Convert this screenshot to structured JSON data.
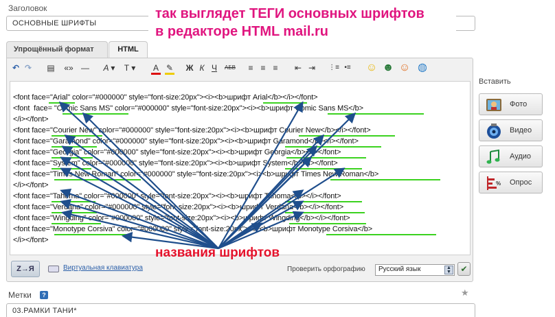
{
  "title_field": {
    "label": "Заголовок",
    "value": "ОСНОВНЫЕ ШРИФТЫ"
  },
  "annotation_top": {
    "line1": "так выглядет ТЕГИ основных шрифтов",
    "line2": "в редакторе HTML mail.ru",
    "color": "#e0157f"
  },
  "tabs": [
    {
      "label": "Упрощённый формат",
      "active": false
    },
    {
      "label": "HTML",
      "active": true
    }
  ],
  "toolbar": {
    "items": [
      {
        "name": "undo-icon",
        "glyph": "↶"
      },
      {
        "name": "redo-icon",
        "glyph": "↷"
      },
      {
        "name": "paragraph-format-icon",
        "glyph": "▤"
      },
      {
        "name": "quote-icon",
        "glyph": "«»"
      },
      {
        "name": "horizontal-rule-icon",
        "glyph": "—"
      },
      {
        "name": "font-name-icon",
        "glyph": "A ▾"
      },
      {
        "name": "font-size-icon",
        "glyph": "T ▾"
      },
      {
        "name": "text-color-icon",
        "glyph": "A"
      },
      {
        "name": "highlight-icon",
        "glyph": "✎"
      },
      {
        "name": "bold-icon",
        "glyph": "Ж"
      },
      {
        "name": "italic-icon",
        "glyph": "К"
      },
      {
        "name": "underline-icon",
        "glyph": "Ч"
      },
      {
        "name": "strikethrough-icon",
        "glyph": "АБВ"
      },
      {
        "name": "align-left-icon",
        "glyph": "≡"
      },
      {
        "name": "align-center-icon",
        "glyph": "≡"
      },
      {
        "name": "align-right-icon",
        "glyph": "≡"
      },
      {
        "name": "outdent-icon",
        "glyph": "⇤"
      },
      {
        "name": "indent-icon",
        "glyph": "⇥"
      },
      {
        "name": "numbered-list-icon",
        "glyph": "⋮≡"
      },
      {
        "name": "bullet-list-icon",
        "glyph": "•≡"
      },
      {
        "name": "smiley-icon",
        "glyph": "☺"
      },
      {
        "name": "user-icon",
        "glyph": "☻"
      },
      {
        "name": "emoticons-icon",
        "glyph": "☺"
      },
      {
        "name": "globe-icon",
        "glyph": "◍"
      }
    ]
  },
  "code_lines": [
    "<font face=\"Arial\" color=\"#000000\" style=\"font-size:20px\"><i><b>шрифт Arial</b></i></font>",
    "<font  face= \"Comic Sans MS\" color=\"#000000\" style=\"font-size:20px\"><i><b>шрифт Comic Sans MS</b>",
    "</i></font>",
    "<font face=\"Courier New\" color=\"#000000\" style=\"font-size:20px\"><i><b>шрифт Courier New</b></i></font>",
    "<font face=\"Garamond\" color=\"#000000\" style=\"font-size:20px\"><i><b>шрифт Garamond</b></i></font>",
    "<font face=\"Georgia\" color=\"#000000\" style=\"font-size:20px\"><i><b>шрифт Georgia</b></i></font>",
    "<font face=\"System\" color=\"#000000\" style=\"font-size:20px\"><i><b>шрифт System</b></i></font>",
    "<font face=\"Times New Roman\" color=\"#000000\" style=\"font-size:20px\"><i><b>шрифт Times New Roman</b>",
    "</i></font>",
    "<font face=\"Tahoma\" color=\"#000000\" style=\"font-size:20px\"><i><b>шрифт Tahoma</b></i></font>",
    "<font face=\"Verdana\" color=\"#000000\" style=\"font-size:20px\"><i><b>шрифт Verdana</b></i></font>",
    "<font face=\"Wingding\" color=\"#000000\" style=\"font-size:20px\"><i><b>шрифт Wingding</b></i></font>",
    "<font face=\"Monotype Corsiva\" color=\"#000000\" style=\"font-size:20px\"><i><b>шрифт Monotype Corsiva</b>",
    "</i></font>"
  ],
  "annotation_bottom": {
    "text": "названия шрифтов",
    "color": "#e5122b"
  },
  "arrow_color": "#1f4e8c",
  "underline_color": "#3bd21f",
  "bottom_bar": {
    "zy_button": "Z→Я",
    "keyboard_link": "Виртуальная клавиатура",
    "spellcheck_label": "Проверить орфографию",
    "language": "Русский язык"
  },
  "sidebar": {
    "insert_label": "Вставить",
    "buttons": [
      {
        "label": "Фото",
        "icon": "photo-icon"
      },
      {
        "label": "Видео",
        "icon": "video-icon"
      },
      {
        "label": "Аудио",
        "icon": "audio-icon"
      },
      {
        "label": "Опрос",
        "icon": "poll-icon"
      }
    ]
  },
  "tags_field": {
    "label": "Метки",
    "help": "?",
    "value": "03.РАМКИ ТАНИ*"
  }
}
